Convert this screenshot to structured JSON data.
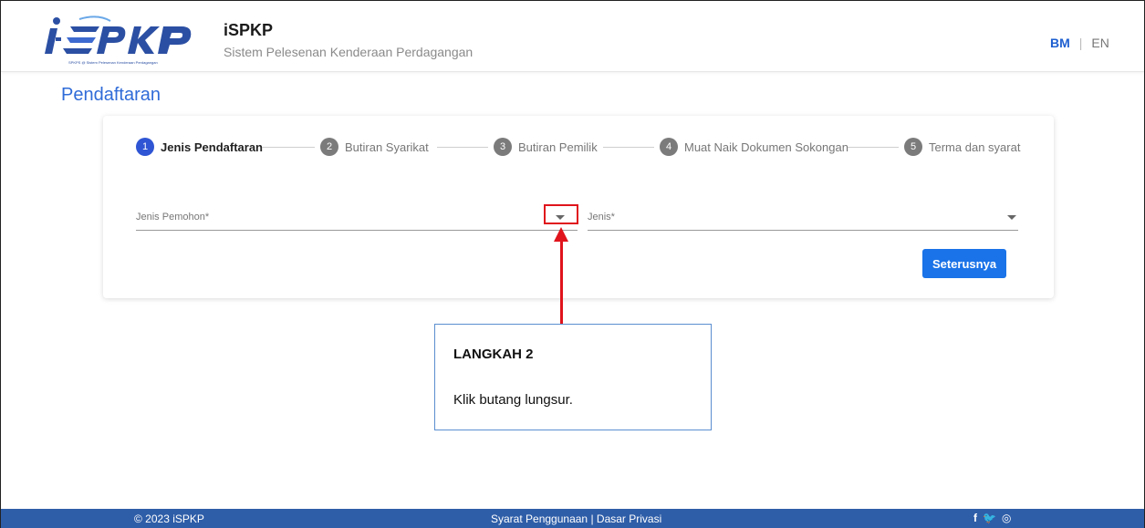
{
  "header": {
    "app_title": "iSPKP",
    "app_subtitle": "Sistem Pelesenan Kenderaan Perdagangan",
    "logo_text": "i·SPKP",
    "logo_tagline": "SPKPS @ Sistem Pelesenan Kenderaan Perdagangan",
    "lang_bm": "BM",
    "lang_sep": "|",
    "lang_en": "EN"
  },
  "page_title": "Pendaftaran",
  "steps": [
    {
      "num": "1",
      "label": "Jenis Pendaftaran",
      "active": true
    },
    {
      "num": "2",
      "label": "Butiran Syarikat",
      "active": false
    },
    {
      "num": "3",
      "label": "Butiran Pemilik",
      "active": false
    },
    {
      "num": "4",
      "label": "Muat Naik Dokumen Sokongan",
      "active": false
    },
    {
      "num": "5",
      "label": "Terma dan syarat",
      "active": false
    }
  ],
  "form": {
    "applicant_type_label": "Jenis Pemohon*",
    "type_label": "Jenis*",
    "next_button": "Seterusnya"
  },
  "annotation": {
    "title": "LANGKAH 2",
    "text": "Klik butang lungsur."
  },
  "footer": {
    "copyright": "© 2023 iSPKP",
    "terms": "Syarat Penggunaan",
    "links_sep": "|",
    "privacy": "Dasar Privasi",
    "social": [
      "f",
      "🐦",
      "◎"
    ]
  },
  "colors": {
    "brand_blue": "#2f6bd8",
    "button_blue": "#1a73e8",
    "footer_blue": "#2f5ea8",
    "annotation_red": "#e0141c"
  }
}
